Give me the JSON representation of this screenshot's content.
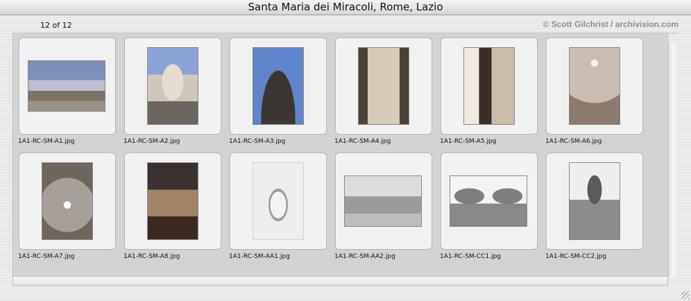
{
  "window": {
    "title": "Santa Maria dei Miracoli, Rome, Lazio"
  },
  "status": {
    "count": "12 of 12",
    "credit": "© Scott Gilchrist / archivision.com"
  },
  "thumbnails": [
    {
      "filename": "1A1-RC-SM-A1.jpg"
    },
    {
      "filename": "1A1-RC-SM-A2.jpg"
    },
    {
      "filename": "1A1-RC-SM-A3.jpg"
    },
    {
      "filename": "1A1-RC-SM-A4.jpg"
    },
    {
      "filename": "1A1-RC-SM-A5.jpg"
    },
    {
      "filename": "1A1-RC-SM-A6.jpg"
    },
    {
      "filename": "1A1-RC-SM-A7.jpg"
    },
    {
      "filename": "1A1-RC-SM-A8.jpg"
    },
    {
      "filename": "1A1-RC-SM-AA1.jpg"
    },
    {
      "filename": "1A1-RC-SM-AA2.jpg"
    },
    {
      "filename": "1A1-RC-SM-CC1.jpg"
    },
    {
      "filename": "1A1-RC-SM-CC2.jpg"
    }
  ]
}
